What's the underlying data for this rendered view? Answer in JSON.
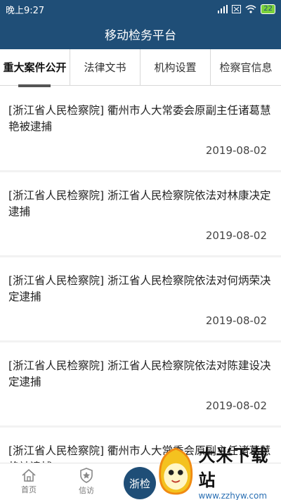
{
  "status_bar": {
    "time": "晚上9:27",
    "battery": "22",
    "icons": [
      "signal-icon",
      "sim-icon",
      "wifi-icon",
      "battery-icon"
    ]
  },
  "app": {
    "title": "移动检务平台"
  },
  "tabs": [
    {
      "label": "重大案件公开",
      "active": true
    },
    {
      "label": "法律文书",
      "active": false
    },
    {
      "label": "机构设置",
      "active": false
    },
    {
      "label": "检察官信息",
      "active": false
    }
  ],
  "items": [
    {
      "title": "[浙江省人民检察院] 衢州市人大常委会原副主任诸葛慧艳被逮捕",
      "date": "2019-08-02"
    },
    {
      "title": "[浙江省人民检察院] 浙江省人民检察院依法对林康决定逮捕",
      "date": "2019-08-02"
    },
    {
      "title": "[浙江省人民检察院] 浙江省人民检察院依法对何炳荣决定逮捕",
      "date": "2019-08-02"
    },
    {
      "title": "[浙江省人民检察院] 浙江省人民检察院依法对陈建设决定逮捕",
      "date": "2019-08-02"
    },
    {
      "title": "[浙江省人民检察院] 衢州市人大常委会原副主任诸葛慧艳被逮捕",
      "date": ""
    }
  ],
  "bottom_nav": {
    "home": "首页",
    "letters": "信访",
    "center": "浙检"
  },
  "watermark": {
    "title": "大米下载站",
    "url": "www.zzhyw.com"
  },
  "colors": {
    "primary": "#1f4e77",
    "accent_green": "#7ad13a"
  }
}
